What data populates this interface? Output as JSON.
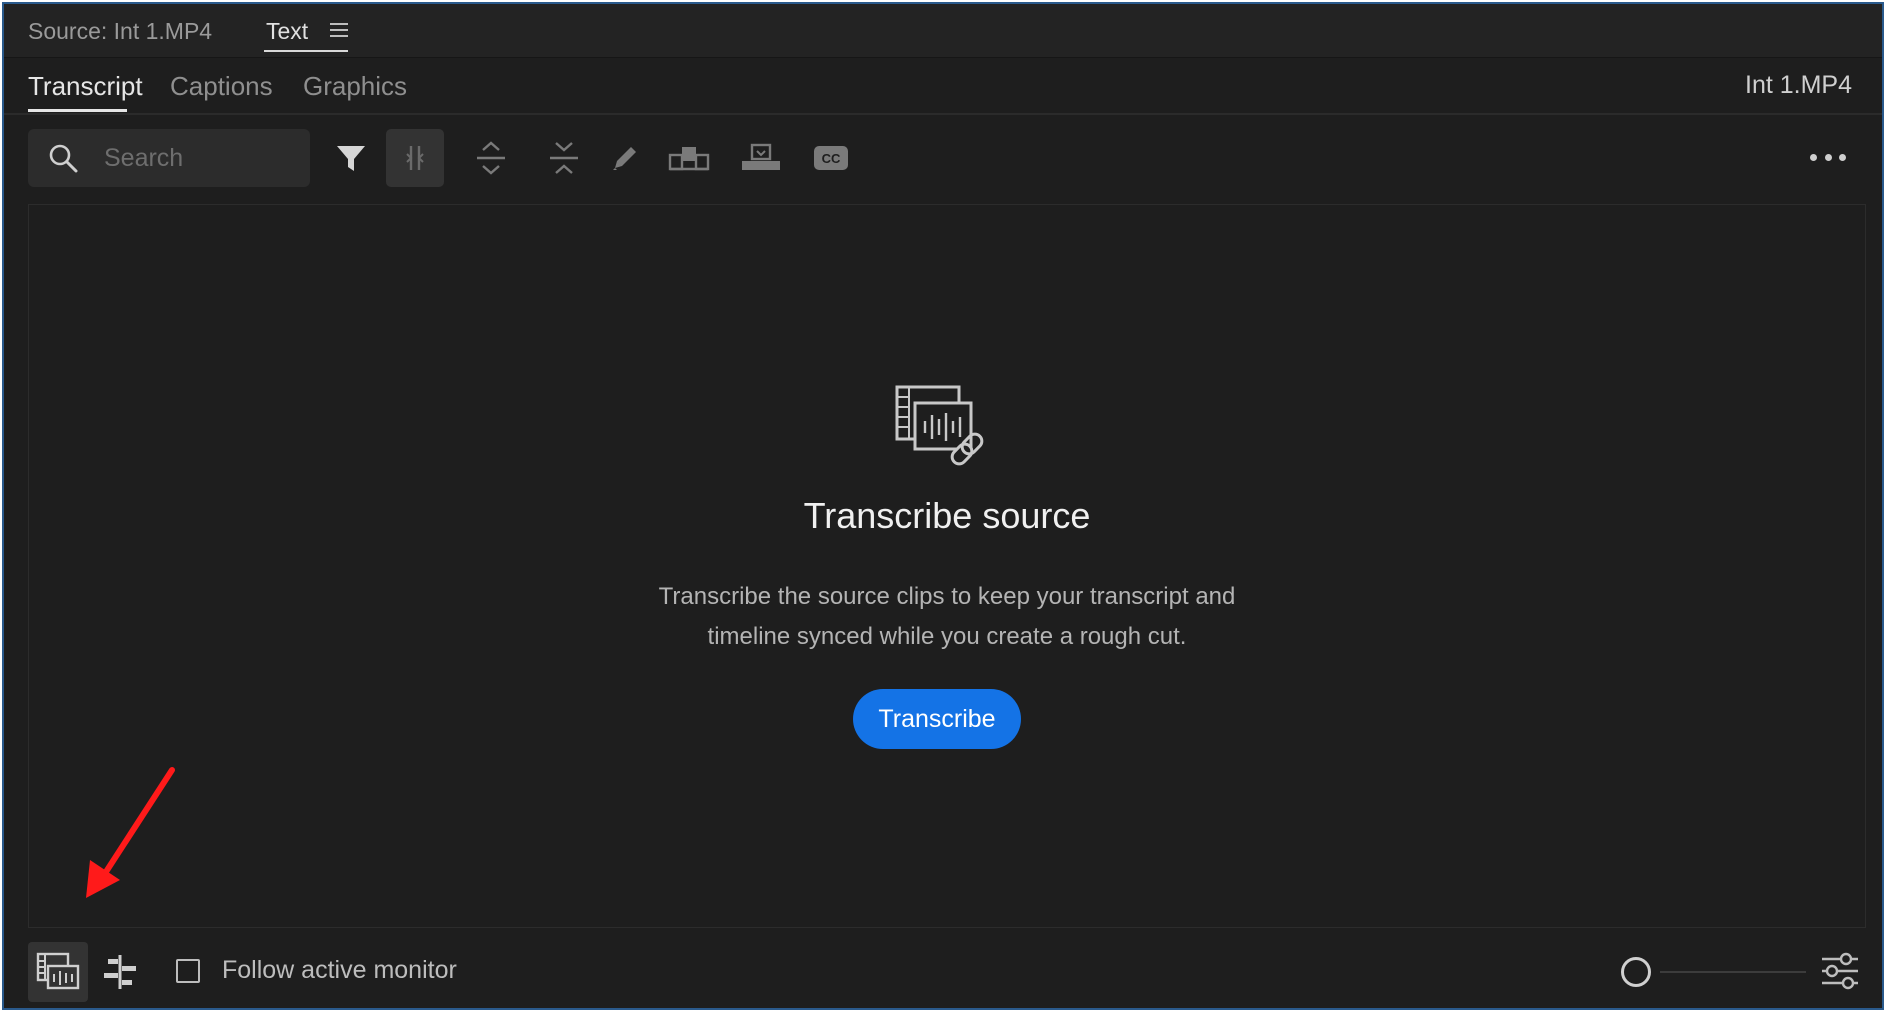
{
  "panel_header": {
    "source_label": "Source: Int 1.MP4",
    "text_tab_label": "Text"
  },
  "subtabs": {
    "items": [
      {
        "label": "Transcript",
        "active": true
      },
      {
        "label": "Captions",
        "active": false
      },
      {
        "label": "Graphics",
        "active": false
      }
    ],
    "clip_name": "Int 1.MP4"
  },
  "toolbar": {
    "search_placeholder": "Search",
    "icons": [
      "filter-icon",
      "split-icon",
      "expand-icon",
      "collapse-icon",
      "pencil-icon",
      "insert-icon",
      "overwrite-icon",
      "closed-captions-icon",
      "more-icon"
    ]
  },
  "empty_state": {
    "icon": "transcribe-source-icon",
    "title": "Transcribe source",
    "description_line1": "Transcribe the source clips to keep your transcript and",
    "description_line2": "timeline synced while you create a rough cut.",
    "button_label": "Transcribe"
  },
  "bottom_bar": {
    "follow_label": "Follow active monitor",
    "follow_checked": false,
    "zoom_level": 0
  },
  "colors": {
    "panel_bg": "#1e1e1e",
    "accent_button": "#1473e6",
    "annotation_arrow": "#ff1a1a",
    "panel_border": "#2a5a8c"
  }
}
